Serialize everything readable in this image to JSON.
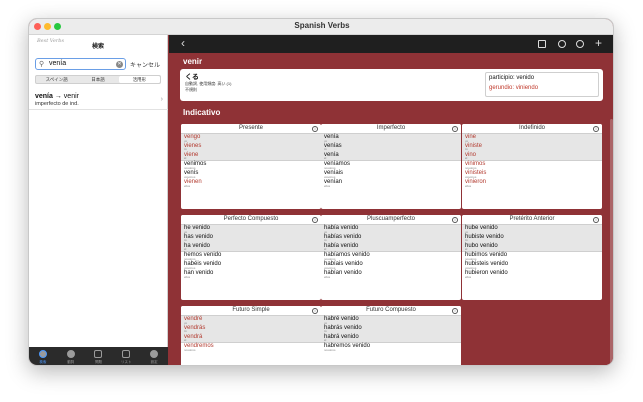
{
  "window": {
    "title": "Spanish Verbs"
  },
  "sidebar": {
    "logo": "Best Verbs",
    "title": "検索",
    "search": {
      "value": "venía",
      "cancel": "キャンセル"
    },
    "segments": [
      "スペイン語",
      "日本語",
      "活用形"
    ],
    "active_segment": 2,
    "result": {
      "form": "venía",
      "arrow": " → ",
      "verb": "venir",
      "detail": "imperfecto de ind."
    },
    "tabs": [
      {
        "label": "検索",
        "icon": "search-icon"
      },
      {
        "label": "動詞",
        "icon": "person-icon"
      },
      {
        "label": "問題",
        "icon": "book-icon"
      },
      {
        "label": "リスト",
        "icon": "list-icon"
      },
      {
        "label": "設定",
        "icon": "gear-icon"
      }
    ]
  },
  "verb": {
    "infinitive": "venir",
    "japanese": "くる",
    "description": "自動詞, 使用頻度: 高い (1)",
    "irregular": "不規則",
    "participle_label": "participio:",
    "participle": "venido",
    "gerund_label": "gerundio:",
    "gerund": "viniendo"
  },
  "mood": "Indicativo",
  "tenses": [
    {
      "title": "Presente",
      "forms": [
        {
          "f": "vengo",
          "p": "yo",
          "irr": true
        },
        {
          "f": "vienes",
          "p": "tú",
          "irr": true
        },
        {
          "f": "viene",
          "p": "él",
          "irr": true
        },
        {
          "f": "venimos",
          "p": "nosotros",
          "irr": false
        },
        {
          "f": "venís",
          "p": "vosotros",
          "irr": false
        },
        {
          "f": "vienen",
          "p": "ellos",
          "irr": true
        }
      ]
    },
    {
      "title": "Imperfecto",
      "forms": [
        {
          "f": "venía",
          "p": "yo",
          "irr": false
        },
        {
          "f": "venías",
          "p": "tú",
          "irr": false
        },
        {
          "f": "venía",
          "p": "él",
          "irr": false
        },
        {
          "f": "veníamos",
          "p": "nosotros",
          "irr": false
        },
        {
          "f": "veníais",
          "p": "vosotros",
          "irr": false
        },
        {
          "f": "venían",
          "p": "ellos",
          "irr": false
        }
      ]
    },
    {
      "title": "Indefinido",
      "forms": [
        {
          "f": "vine",
          "p": "yo",
          "irr": true
        },
        {
          "f": "viniste",
          "p": "tú",
          "irr": true
        },
        {
          "f": "vino",
          "p": "él",
          "irr": true
        },
        {
          "f": "vinimos",
          "p": "nosotros",
          "irr": true
        },
        {
          "f": "vinisteis",
          "p": "vosotros",
          "irr": true
        },
        {
          "f": "vinieron",
          "p": "ellos",
          "irr": true
        }
      ]
    },
    {
      "title": "Perfecto Compuesto",
      "forms": [
        {
          "f": "he venido",
          "p": "yo",
          "irr": false
        },
        {
          "f": "has venido",
          "p": "tú",
          "irr": false
        },
        {
          "f": "ha venido",
          "p": "él",
          "irr": false
        },
        {
          "f": "hemos venido",
          "p": "nosotros",
          "irr": false
        },
        {
          "f": "habéis venido",
          "p": "vosotros",
          "irr": false
        },
        {
          "f": "han venido",
          "p": "ellos",
          "irr": false
        }
      ]
    },
    {
      "title": "Pluscuamperfecto",
      "forms": [
        {
          "f": "había venido",
          "p": "yo",
          "irr": false
        },
        {
          "f": "habías venido",
          "p": "tú",
          "irr": false
        },
        {
          "f": "había venido",
          "p": "él",
          "irr": false
        },
        {
          "f": "habíamos venido",
          "p": "nosotros",
          "irr": false
        },
        {
          "f": "habíais venido",
          "p": "vosotros",
          "irr": false
        },
        {
          "f": "habían venido",
          "p": "ellos",
          "irr": false
        }
      ]
    },
    {
      "title": "Pretérito Anterior",
      "forms": [
        {
          "f": "hube venido",
          "p": "yo",
          "irr": false
        },
        {
          "f": "hubiste venido",
          "p": "tú",
          "irr": false
        },
        {
          "f": "hubo venido",
          "p": "él",
          "irr": false
        },
        {
          "f": "hubimos venido",
          "p": "nosotros",
          "irr": false
        },
        {
          "f": "hubisteis venido",
          "p": "vosotros",
          "irr": false
        },
        {
          "f": "hubieron venido",
          "p": "ellos",
          "irr": false
        }
      ]
    },
    {
      "title": "Futuro Simple",
      "forms": [
        {
          "f": "vendré",
          "p": "yo",
          "irr": true
        },
        {
          "f": "vendrás",
          "p": "tú",
          "irr": true
        },
        {
          "f": "vendrá",
          "p": "él",
          "irr": true
        },
        {
          "f": "vendremos",
          "p": "nosotros",
          "irr": true
        }
      ]
    },
    {
      "title": "Futuro Compuesto",
      "forms": [
        {
          "f": "habré venido",
          "p": "yo",
          "irr": false
        },
        {
          "f": "habrás venido",
          "p": "tú",
          "irr": false
        },
        {
          "f": "habrá venido",
          "p": "él",
          "irr": false
        },
        {
          "f": "habremos venido",
          "p": "nosotros",
          "irr": false
        }
      ]
    }
  ],
  "colors": {
    "accent": "#8f3236",
    "irregular_form": "#b23a2f",
    "active_tab": "#4c9aff"
  }
}
